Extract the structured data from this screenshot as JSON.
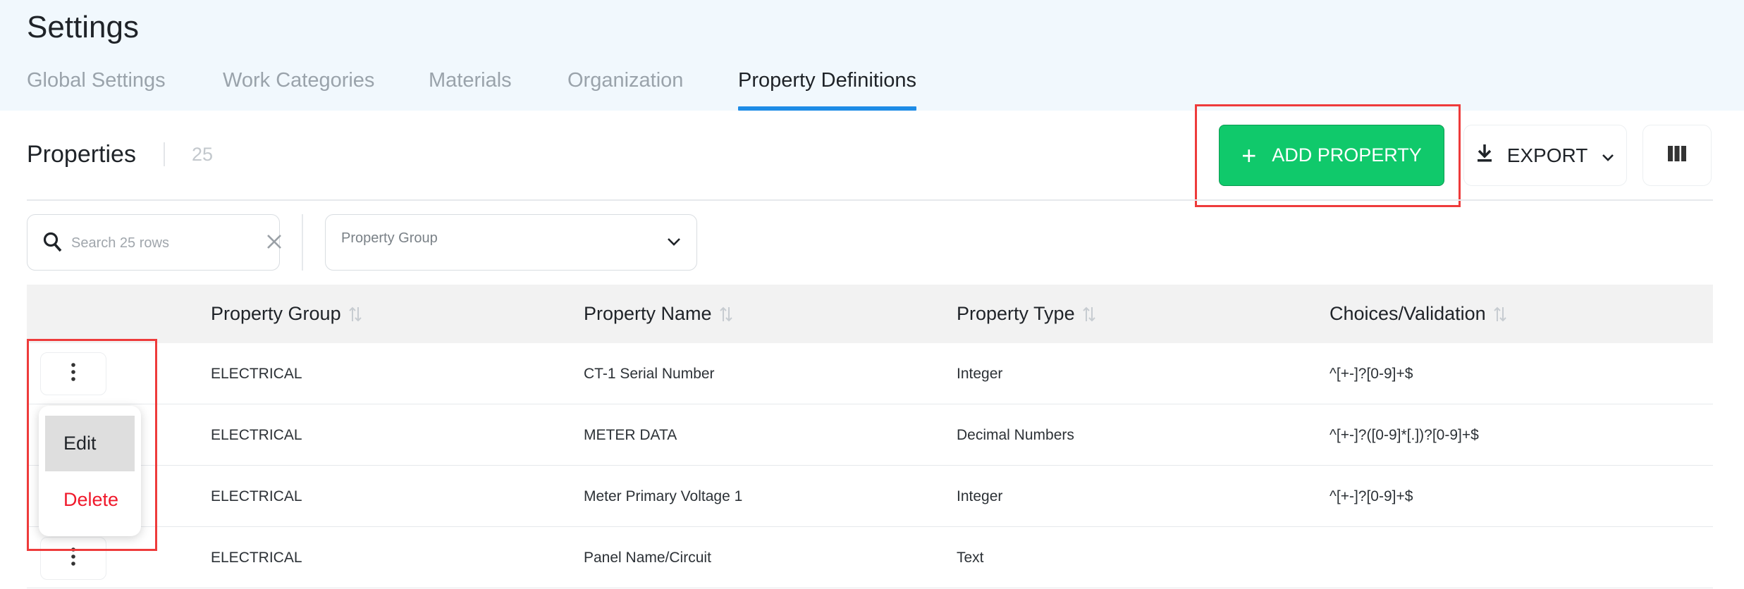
{
  "page": {
    "title": "Settings"
  },
  "tabs": [
    {
      "label": "Global Settings",
      "active": false
    },
    {
      "label": "Work Categories",
      "active": false
    },
    {
      "label": "Materials",
      "active": false
    },
    {
      "label": "Organization",
      "active": false
    },
    {
      "label": "Property Definitions",
      "active": true
    }
  ],
  "toolbar": {
    "title": "Properties",
    "count": "25",
    "add_label": "ADD PROPERTY",
    "add_icon": "plus-icon",
    "export_label": "EXPORT",
    "export_icon": "download-icon",
    "columns_icon": "columns-icon"
  },
  "filters": {
    "search_placeholder": "Search 25 rows",
    "search_value": "",
    "group_select_label": "Property Group"
  },
  "table": {
    "columns": [
      "Property Group",
      "Property Name",
      "Property Type",
      "Choices/Validation"
    ],
    "rows": [
      [
        "ELECTRICAL",
        "CT-1 Serial Number",
        "Integer",
        "^[+-]?[0-9]+$"
      ],
      [
        "ELECTRICAL",
        "METER DATA",
        "Decimal Numbers",
        "^[+-]?([0-9]*[.])?[0-9]+$"
      ],
      [
        "ELECTRICAL",
        "Meter Primary Voltage 1",
        "Integer",
        "^[+-]?[0-9]+$"
      ],
      [
        "ELECTRICAL",
        "Panel Name/Circuit",
        "Text",
        ""
      ]
    ]
  },
  "row_menu": {
    "edit_label": "Edit",
    "delete_label": "Delete"
  },
  "colors": {
    "accent": "#1e8ce6",
    "primary_button": "#10c96b",
    "danger": "#f0192b",
    "highlight": "#ee3b3b",
    "header_bg": "#f1f8fd"
  }
}
